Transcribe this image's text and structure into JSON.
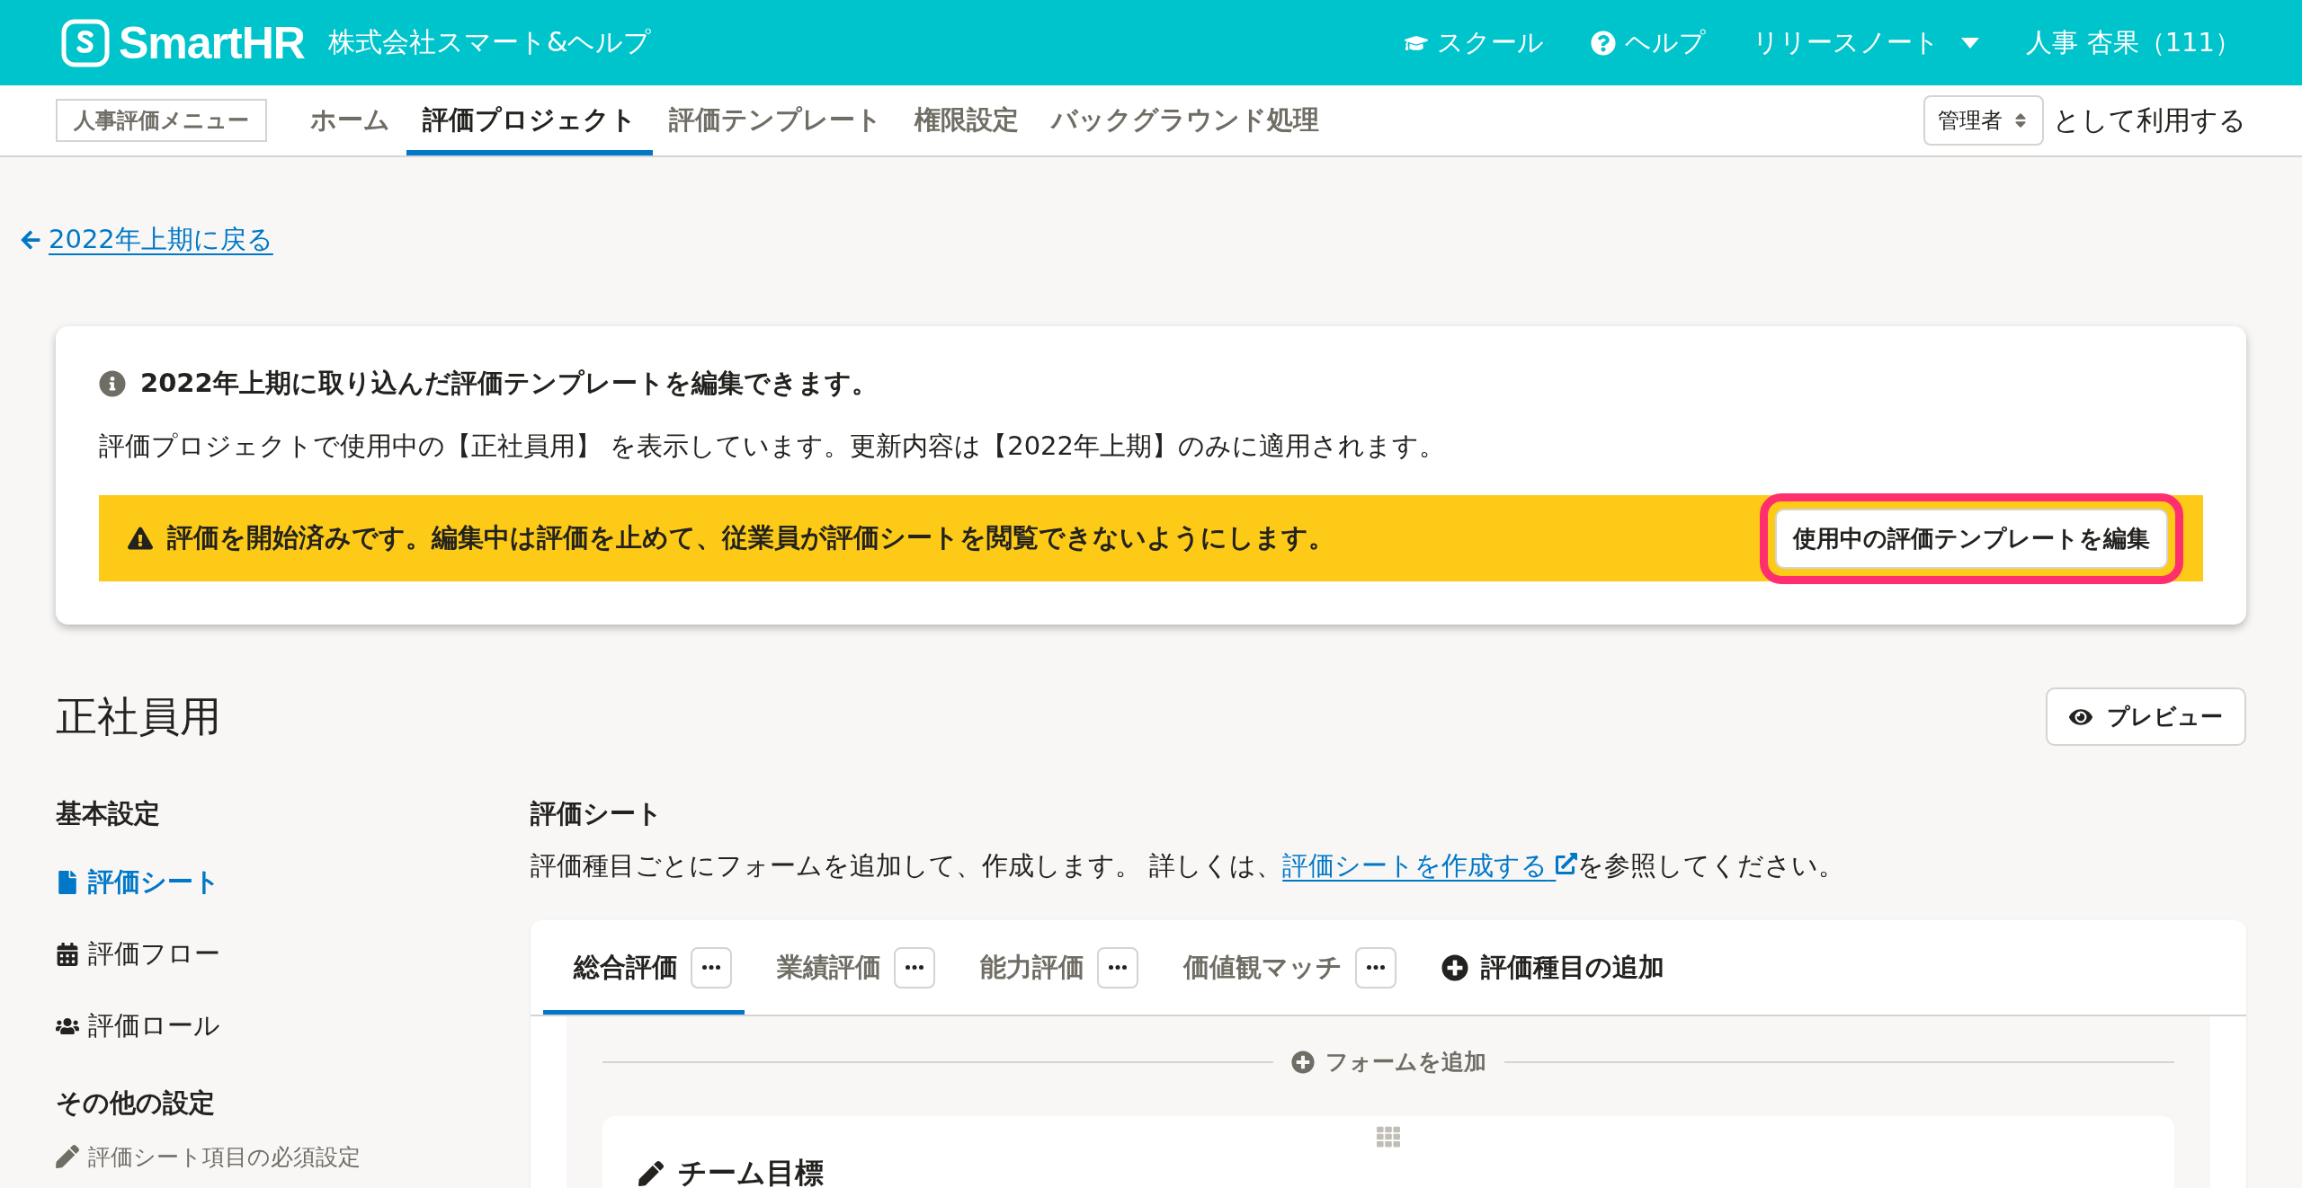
{
  "header": {
    "logo": "SmartHR",
    "company": "株式会社スマート&ヘルプ",
    "links": [
      {
        "kind": "school",
        "label": "スクール"
      },
      {
        "kind": "help",
        "label": "ヘルプ"
      },
      {
        "kind": "dropdown",
        "label": "リリースノート"
      }
    ],
    "user": "人事 杏果（111）"
  },
  "nav": {
    "menu_label": "人事評価メニュー",
    "items": [
      {
        "label": "ホーム",
        "selected": false
      },
      {
        "label": "評価プロジェクト",
        "selected": true
      },
      {
        "label": "評価テンプレート",
        "selected": false
      },
      {
        "label": "権限設定",
        "selected": false
      },
      {
        "label": "バックグラウンド処理",
        "selected": false
      }
    ],
    "role": "管理者",
    "role_suffix": "として利用する"
  },
  "back_link": "2022年上期に戻る",
  "notice": {
    "title": "2022年上期に取り込んだ評価テンプレートを編集できます。",
    "body": "評価プロジェクトで使用中の【正社員用】 を表示しています。更新内容は【2022年上期】のみに適用されます。",
    "warning": "評価を開始済みです。編集中は評価を止めて、従業員が評価シートを閲覧できないようにします。",
    "button": {
      "label": "使用中の評価テンプレートを編集",
      "highlighted": true
    }
  },
  "page_title": "正社員用",
  "preview_button": "プレビュー",
  "sidebar": {
    "sections": [
      {
        "heading": "基本設定",
        "items": [
          {
            "kind": "file",
            "label": "評価シート",
            "selected": true,
            "disabled": false
          },
          {
            "kind": "calendar",
            "label": "評価フロー",
            "selected": false,
            "disabled": false
          },
          {
            "kind": "users",
            "label": "評価ロール",
            "selected": false,
            "disabled": false
          }
        ]
      },
      {
        "heading": "その他の設定",
        "items": [
          {
            "kind": "pen",
            "label": "評価シート項目の必須設定",
            "selected": false,
            "disabled": true
          }
        ]
      }
    ]
  },
  "sheet": {
    "heading": "評価シート",
    "description": "評価種目ごとにフォームを追加して、作成します。 詳しくは、",
    "link": "評価シートを作成する",
    "description_after": "を参照してください。",
    "tabs": [
      {
        "label": "総合評価",
        "selected": true
      },
      {
        "label": "業績評価",
        "selected": false
      },
      {
        "label": "能力評価",
        "selected": false
      },
      {
        "label": "価値観マッチ",
        "selected": false
      }
    ],
    "add_tab": "評価種目の追加",
    "add_form": "フォームを追加",
    "form": {
      "title": "チーム目標"
    }
  }
}
